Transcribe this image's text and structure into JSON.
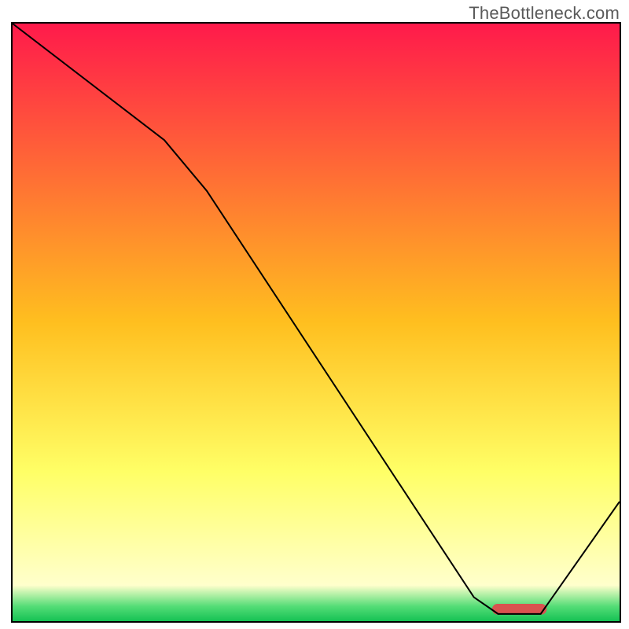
{
  "watermark": "TheBottleneck.com",
  "chart_data": {
    "type": "line",
    "title": "",
    "xlabel": "",
    "ylabel": "",
    "xlim": [
      0,
      100
    ],
    "ylim": [
      0,
      100
    ],
    "gradient_stops": [
      {
        "offset": 0.0,
        "color": "#ff1a4b"
      },
      {
        "offset": 0.5,
        "color": "#ffbf1f"
      },
      {
        "offset": 0.75,
        "color": "#ffff66"
      },
      {
        "offset": 0.94,
        "color": "#ffffcc"
      },
      {
        "offset": 0.975,
        "color": "#55dd77"
      },
      {
        "offset": 1.0,
        "color": "#15c254"
      }
    ],
    "curve": [
      {
        "x": 0,
        "y": 100
      },
      {
        "x": 25,
        "y": 80.5
      },
      {
        "x": 32,
        "y": 72
      },
      {
        "x": 76,
        "y": 4
      },
      {
        "x": 80,
        "y": 1.2
      },
      {
        "x": 87,
        "y": 1.2
      },
      {
        "x": 100,
        "y": 20
      }
    ],
    "marker": {
      "x_start": 79,
      "x_end": 88,
      "y": 2,
      "color": "#d9534f"
    }
  }
}
